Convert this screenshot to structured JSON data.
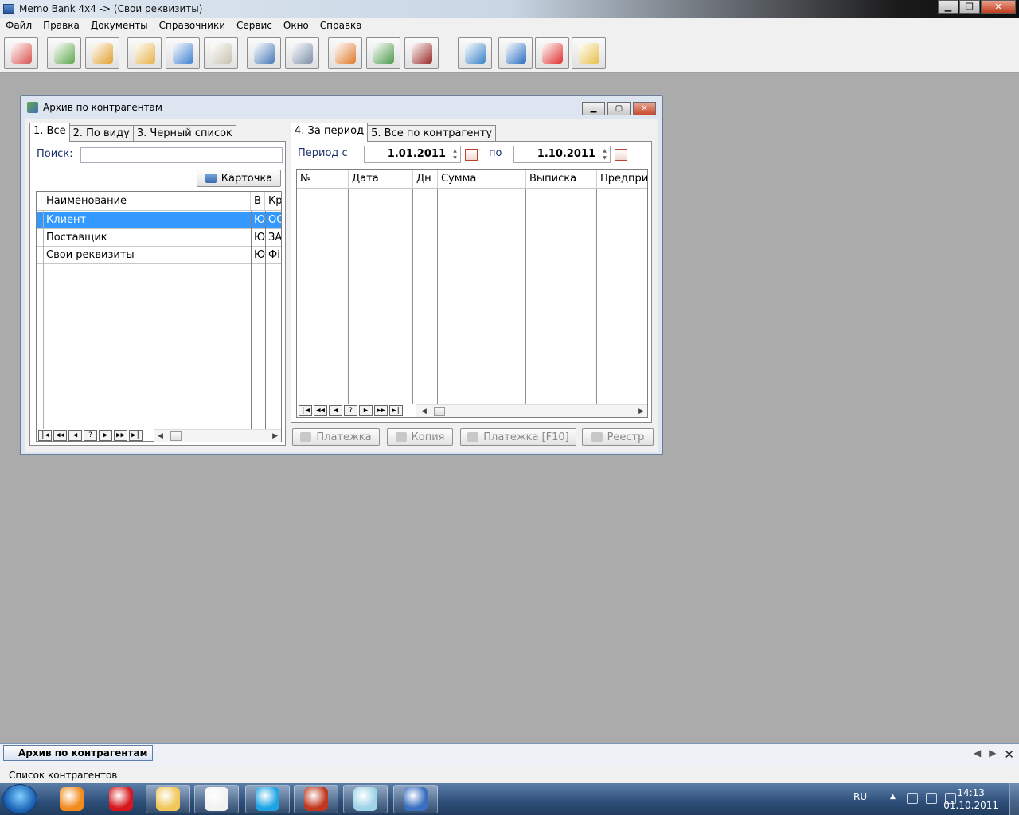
{
  "window": {
    "title": "Memo Bank 4x4 -> (Свои реквизиты)",
    "min": "▁",
    "max": "❐",
    "close": "✕"
  },
  "menu": [
    "Файл",
    "Правка",
    "Документы",
    "Справочники",
    "Сервис",
    "Окно",
    "Справка"
  ],
  "toolbar_icons": [
    {
      "name": "edit-document-icon",
      "color": "#d9534f"
    },
    {
      "name": "contact-card-icon",
      "color": "#5fa84e"
    },
    {
      "name": "users-icon",
      "color": "#e0a030"
    },
    {
      "name": "folders-icon",
      "color": "#e6b24a"
    },
    {
      "name": "bar-chart-icon",
      "color": "#3f80d0"
    },
    {
      "name": "documents-icon",
      "color": "#c9c2b0"
    },
    {
      "name": "disk-save-icon",
      "color": "#4a7ab8"
    },
    {
      "name": "disk-open-icon",
      "color": "#7d8fa8"
    },
    {
      "name": "tools-icon",
      "color": "#e07a2a"
    },
    {
      "name": "accounting-icon",
      "color": "#4d9a4d"
    },
    {
      "name": "wallet-icon",
      "color": "#9a2828"
    },
    {
      "name": "network-computer-icon",
      "color": "#3a84c8"
    },
    {
      "name": "internet-globe-icon",
      "color": "#2a6fc0"
    },
    {
      "name": "help-lifebuoy-icon",
      "color": "#e03030"
    },
    {
      "name": "mail-send-icon",
      "color": "#e8c048"
    }
  ],
  "child": {
    "title": "Архив по контрагентам",
    "min": "▁",
    "max": "▢",
    "close": "✕"
  },
  "left_tabs": [
    "1. Все",
    "2. По виду",
    "3. Черный список"
  ],
  "search": {
    "label": "Поиск:",
    "value": ""
  },
  "card_button": "Карточка",
  "left_grid": {
    "columns": [
      "Наименование",
      "В",
      "Кр"
    ],
    "rows": [
      {
        "name": "Клиент",
        "type": "Ю",
        "short": "ОС"
      },
      {
        "name": "Поставщик",
        "type": "Ю",
        "short": "ЗА"
      },
      {
        "name": "Свои реквизиты",
        "type": "Ю",
        "short": "Фі"
      }
    ]
  },
  "nav_buttons": [
    "|◀",
    "◀◀",
    "◀",
    "?",
    "▶",
    "▶▶",
    "▶|"
  ],
  "right_tabs": [
    "4. За период",
    "5. Все по контрагенту"
  ],
  "period": {
    "from_label": "Период с",
    "from": "1.01.2011",
    "to_label": "по",
    "to": "1.10.2011"
  },
  "right_grid": {
    "columns": [
      "№",
      "Дата",
      "Дн",
      "Сумма",
      "Выписка",
      "Предпри"
    ]
  },
  "bottom_buttons": [
    "Платежка",
    "Копия",
    "Платежка [F10]",
    "Реестр"
  ],
  "doc_tab": "Архив по контрагентам",
  "status": "Список контрагентов",
  "tray": {
    "lang": "RU",
    "time": "14:13",
    "date": "01.10.2011"
  },
  "taskbar_apps": [
    {
      "name": "avast-icon",
      "color": "#f28c1e"
    },
    {
      "name": "opera-icon",
      "color": "#d6181e"
    },
    {
      "name": "explorer-folder-icon",
      "color": "#f1c75a"
    },
    {
      "name": "panda-icon",
      "color": "#f2f2f2"
    },
    {
      "name": "skype-icon",
      "color": "#1ea4e3"
    },
    {
      "name": "game-icon",
      "color": "#c0391e"
    },
    {
      "name": "notepad-icon",
      "color": "#9fd4e8"
    },
    {
      "name": "memobank-icon",
      "color": "#3a6fc0"
    }
  ]
}
